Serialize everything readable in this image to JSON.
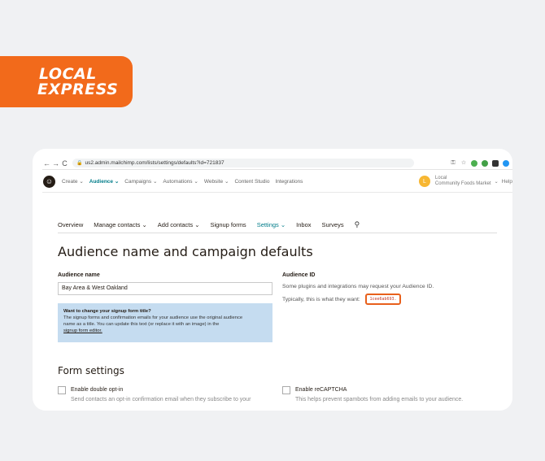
{
  "brand": {
    "line1": "LOCAL",
    "line2": "EXPRESS",
    "color": "#f26a1b"
  },
  "browser": {
    "back": "←",
    "forward": "→",
    "reload": "C",
    "url": "us2.admin.mailchimp.com/lists/settings/defaults?id=721837",
    "icons": [
      "key-icon",
      "star-icon",
      "extension-icon",
      "extension-icon",
      "extension-icon",
      "extension-icon"
    ]
  },
  "app_nav": {
    "items": [
      {
        "label": "Create ⌄",
        "active": false
      },
      {
        "label": "Audience ⌄",
        "active": true
      },
      {
        "label": "Campaigns ⌄",
        "active": false
      },
      {
        "label": "Automations ⌄",
        "active": false
      },
      {
        "label": "Website ⌄",
        "active": false
      },
      {
        "label": "Content Studio",
        "active": false
      },
      {
        "label": "Integrations",
        "active": false
      }
    ],
    "avatar_letter": "L",
    "account_line1": "Local",
    "account_line2": "Community Foods Market",
    "help": "Help"
  },
  "sub_nav": {
    "items": [
      "Overview",
      "Manage contacts ⌄",
      "Add contacts ⌄",
      "Signup forms",
      "Settings ⌄",
      "Inbox",
      "Surveys"
    ],
    "active_index": 4
  },
  "page": {
    "title": "Audience name and campaign defaults",
    "audience_name_label": "Audience name",
    "audience_name_value": "Bay Area & West Oakland",
    "info_box": {
      "head": "Want to change your signup form title?",
      "body1": "The signup forms and confirmation emails for your audience use the original audience",
      "body2": "name as a title. You can update this text (or replace it with an image) in the",
      "link": "signup form editor."
    },
    "audience_id_label": "Audience ID",
    "audience_id_desc": "Some plugins and integrations may request your Audience ID.",
    "audience_id_prefix": "Typically, this is what they want:",
    "audience_id_value": "1cee6ab693."
  },
  "form_settings": {
    "title": "Form settings",
    "double_optin_label": "Enable double opt-in",
    "double_optin_desc": "Send contacts an opt-in confirmation email when they subscribe to your",
    "recaptcha_label": "Enable reCAPTCHA",
    "recaptcha_desc": "This helps prevent spambots from adding emails to your audience."
  }
}
